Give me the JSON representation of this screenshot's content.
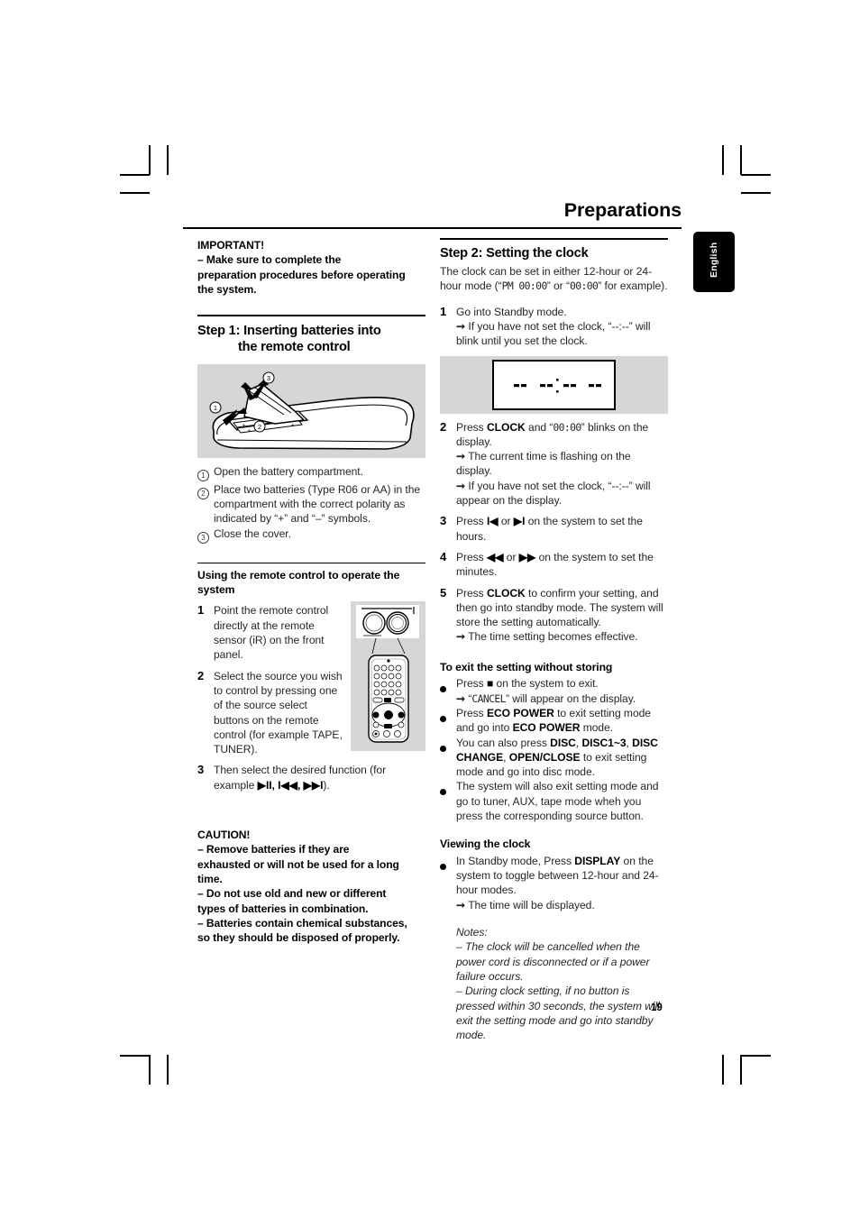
{
  "header": {
    "title": "Preparations",
    "language_tab": "English",
    "page_number": "19"
  },
  "left_column": {
    "important": {
      "heading": "IMPORTANT!",
      "lines": [
        "–  Make sure to complete the",
        "preparation procedures before operating",
        "the system."
      ]
    },
    "step1": {
      "heading_line1": "Step 1: Inserting batteries into",
      "heading_line2": "the remote control",
      "illustration_name": "remote-control-battery-compartment",
      "callouts": [
        "1",
        "2",
        "3"
      ],
      "steps": [
        {
          "num": "1",
          "text": "Open the battery compartment."
        },
        {
          "num": "2",
          "text": "Place two batteries (Type R06 or AA) in the compartment with the correct polarity as indicated by “+” and “–” symbols."
        },
        {
          "num": "3",
          "text": "Close the cover."
        }
      ]
    },
    "using_remote": {
      "heading": "Using the remote control to operate the system",
      "steps": [
        {
          "num": "1",
          "text": "Point the remote control directly at the remote sensor (iR) on the front panel."
        },
        {
          "num": "2",
          "text": "Select the source you wish to control by pressing one of the source select buttons on the remote control (for example TAPE, TUNER)."
        },
        {
          "num": "3",
          "text_pre": "Then select the desired function (for example ",
          "symbols": "▶II, I◀◀, ▶▶I",
          "text_post": ")."
        }
      ],
      "illustration_name": "front-panel-and-remote-control"
    },
    "caution": {
      "heading": "CAUTION!",
      "lines": [
        "–  Remove batteries if they are",
        "exhausted or will not be used for a long",
        "time.",
        "–  Do not use old and new or different",
        "types of batteries in combination.",
        "–  Batteries contain chemical substances,",
        "so they should be disposed of properly."
      ]
    }
  },
  "right_column": {
    "step2": {
      "heading": "Step 2: Setting the clock",
      "intro_pre": "The clock can be set in either 12-hour or 24-hour mode (“",
      "intro_seg1": "PM  00:00",
      "intro_mid": "” or “",
      "intro_seg2": "00:00",
      "intro_post": "” for example).",
      "steps": [
        {
          "num": "1",
          "text": "Go into Standby mode.",
          "arrows": [
            "If you have not set the clock, “--:--” will blink until you set the clock."
          ]
        },
        {
          "num": "2",
          "text_pre": "Press ",
          "bold": "CLOCK",
          "text_mid": " and “",
          "seg": "00:00",
          "text_post": "” blinks on the display.",
          "arrows": [
            "The current time is flashing on the display.",
            "If you have not set the clock, “--:--” will appear on the display."
          ]
        },
        {
          "num": "3",
          "text_pre": "Press ",
          "symbols": "I◀",
          "text_mid": "  or  ",
          "symbols2": "▶I",
          "text_post": " on the system to set the hours."
        },
        {
          "num": "4",
          "text_pre": "Press ",
          "symbols": "◀◀",
          "text_mid": " or ",
          "symbols2": "▶▶",
          "text_post": " on the system to set the minutes."
        },
        {
          "num": "5",
          "text_pre": "Press ",
          "bold": "CLOCK",
          "text_post": " to confirm your setting, and then go into standby mode. The system will store the setting automatically.",
          "arrows": [
            "The time setting becomes effective."
          ]
        }
      ],
      "display_illustration": {
        "name": "clock-display-blank",
        "segments": [
          "--",
          "--",
          "--",
          "--"
        ],
        "colon": ":"
      }
    },
    "exit_section": {
      "heading": "To exit the setting without storing",
      "bullets": [
        {
          "text_pre": "Press ",
          "symbol": "■",
          "text_post": " on the system to exit.",
          "arrows_seg": "CANCEL",
          "arrow_pre": "“",
          "arrow_post": "” will appear on the display."
        },
        {
          "text_pre": "Press ",
          "bold": "ECO POWER",
          "text_mid": " to exit setting mode and go into ",
          "bold2": "ECO POWER",
          "text_post": " mode."
        },
        {
          "text_pre": "You can also press ",
          "bold": "DISC",
          "sep1": ", ",
          "bold2": "DISC1~3",
          "sep2": ", ",
          "bold3": "DISC CHANGE",
          "sep3": ", ",
          "bold4": "OPEN/CLOSE",
          "text_post": " to exit setting mode and go into disc mode."
        },
        {
          "text_pre": "The system will also exit setting mode and go to tuner, AUX, tape mode wheh you press the corresponding source button."
        }
      ]
    },
    "viewing_section": {
      "heading": "Viewing the clock",
      "bullet": {
        "text_pre": "In Standby mode, Press ",
        "bold": "DISPLAY",
        "text_post": " on the system to toggle between 12-hour and 24-hour modes."
      },
      "arrow": "The time will be displayed."
    },
    "notes": {
      "heading": "Notes:",
      "items": [
        "–  The clock will be cancelled when the power cord is disconnected or if a power failure occurs.",
        "–  During clock setting, if no button is pressed within 30 seconds, the system will exit the setting mode and go into standby mode."
      ]
    }
  }
}
